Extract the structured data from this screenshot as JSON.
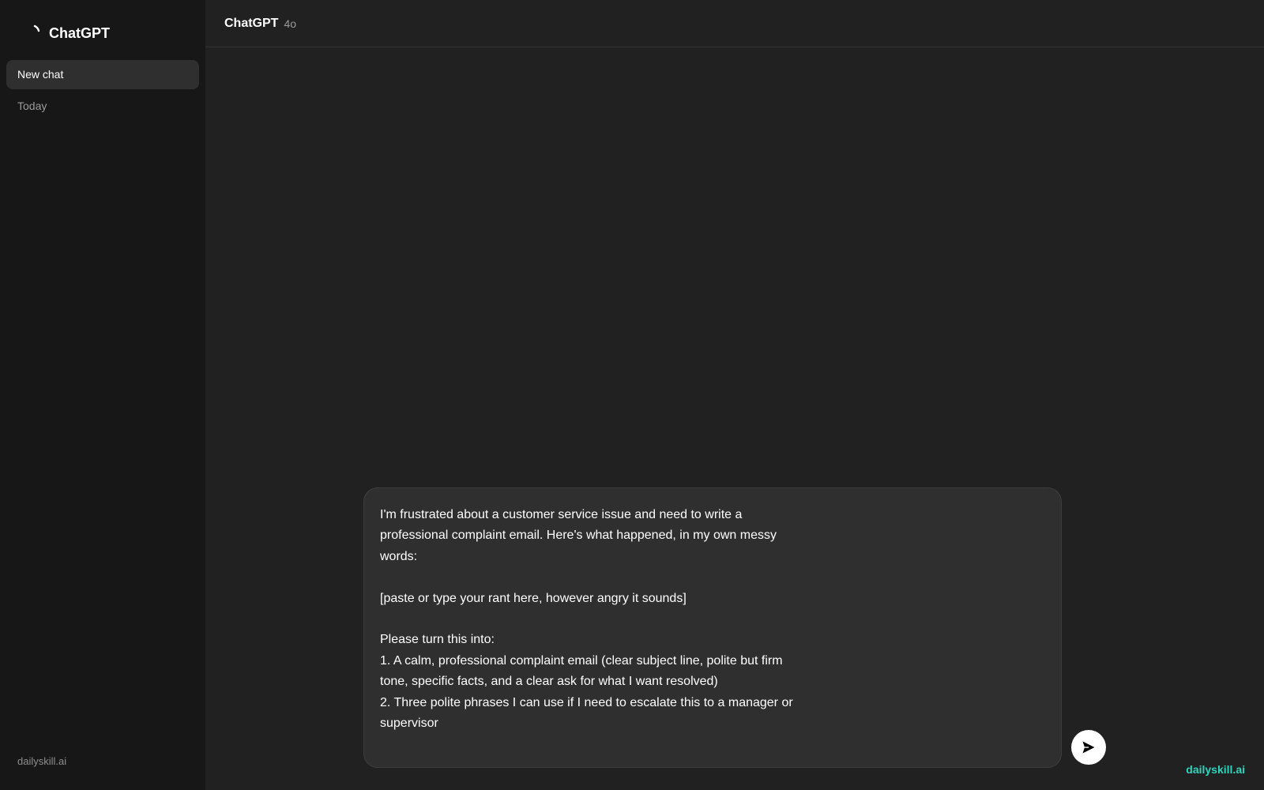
{
  "sidebar": {
    "brand_name": "ChatGPT",
    "new_chat_label": "New chat",
    "section_today": "Today",
    "footer": "dailyskill.ai"
  },
  "header": {
    "title": "ChatGPT",
    "model": "4o"
  },
  "composer": {
    "value": "I'm frustrated about a customer service issue and need to write a professional complaint email. Here's what happened, in my own messy words:\n\n[paste or type your rant here, however angry it sounds]\n\nPlease turn this into:\n1. A calm, professional complaint email (clear subject line, polite but firm tone, specific facts, and a clear ask for what I want resolved)\n2. Three polite phrases I can use if I need to escalate this to a manager or supervisor"
  },
  "watermark": "dailyskill.ai",
  "icons": {
    "brand": "spinner-logo-icon",
    "send": "send-arrow-icon"
  },
  "colors": {
    "main_bg": "#212121",
    "sidebar_bg": "#171717",
    "composer_bg": "#2f2f2f",
    "watermark": "#2dd4bf"
  }
}
